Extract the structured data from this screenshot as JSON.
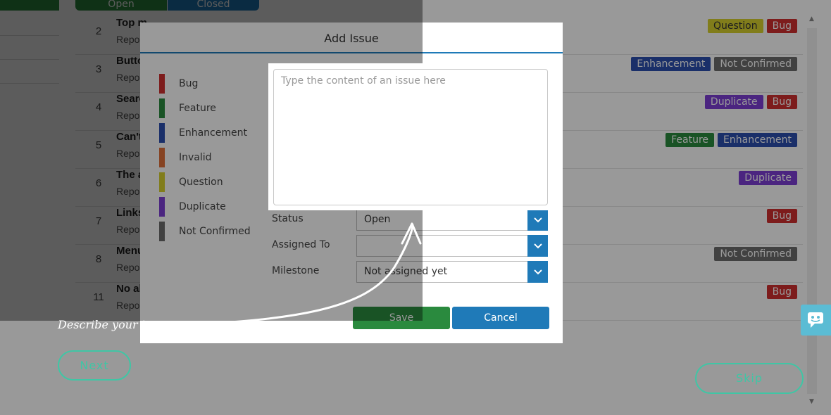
{
  "background": {
    "tabs": {
      "open_label": "Open",
      "closed_label": "Closed"
    },
    "issues": [
      {
        "num": "2",
        "title": "Top m",
        "reporter": "Repo",
        "tags": [
          {
            "label": "Question",
            "color": "#d8d12e",
            "text": "#333"
          },
          {
            "label": "Bug",
            "color": "#d02f2f",
            "text": "#fff"
          }
        ]
      },
      {
        "num": "3",
        "title": "Butto",
        "reporter": "Repo",
        "tags": [
          {
            "label": "Enhancement",
            "color": "#2c4fb0",
            "text": "#fff"
          },
          {
            "label": "Not Confirmed",
            "color": "#6d6d6d",
            "text": "#fff"
          }
        ]
      },
      {
        "num": "4",
        "title": "Searc",
        "reporter": "Repo",
        "tags": [
          {
            "label": "Duplicate",
            "color": "#7d3fd6",
            "text": "#fff"
          },
          {
            "label": "Bug",
            "color": "#d02f2f",
            "text": "#fff"
          }
        ]
      },
      {
        "num": "5",
        "title": "Can't",
        "reporter": "Repo",
        "tags": [
          {
            "label": "Feature",
            "color": "#2a8a3e",
            "text": "#fff"
          },
          {
            "label": "Enhancement",
            "color": "#2c4fb0",
            "text": "#fff"
          }
        ]
      },
      {
        "num": "6",
        "title": "The a",
        "reporter": "Repo",
        "tags": [
          {
            "label": "Duplicate",
            "color": "#7d3fd6",
            "text": "#fff"
          }
        ]
      },
      {
        "num": "7",
        "title": "Links",
        "reporter": "Repo",
        "tags": [
          {
            "label": "Bug",
            "color": "#d02f2f",
            "text": "#fff"
          }
        ]
      },
      {
        "num": "8",
        "title": "Menu",
        "reporter": "Repo",
        "tags": [
          {
            "label": "Not Confirmed",
            "color": "#6d6d6d",
            "text": "#fff"
          }
        ]
      },
      {
        "num": "11",
        "title": "No al",
        "reporter": "Repo",
        "tags": [
          {
            "label": "Bug",
            "color": "#d02f2f",
            "text": "#fff"
          }
        ]
      }
    ]
  },
  "modal": {
    "title": "Add Issue",
    "legend": [
      {
        "label": "Bug",
        "color": "#d02f2f"
      },
      {
        "label": "Feature",
        "color": "#2a8a3e"
      },
      {
        "label": "Enhancement",
        "color": "#2c4fb0"
      },
      {
        "label": "Invalid",
        "color": "#e0703a"
      },
      {
        "label": "Question",
        "color": "#d8d12e"
      },
      {
        "label": "Duplicate",
        "color": "#7d3fd6"
      },
      {
        "label": "Not Confirmed",
        "color": "#6d6d6d"
      }
    ],
    "content_placeholder": "Type the content of an issue here",
    "status": {
      "label": "Status",
      "value": "Open"
    },
    "assigned_to": {
      "label": "Assigned To",
      "value": ""
    },
    "milestone": {
      "label": "Milestone",
      "value": "Not assigned yet"
    },
    "save_label": "Save",
    "cancel_label": "Cancel"
  },
  "tour": {
    "text": "Describe your issue",
    "next_label": "Next",
    "skip_label": "Skip"
  },
  "icons": {
    "chevron": "chevron-down-icon",
    "chat": "chat-icon"
  }
}
